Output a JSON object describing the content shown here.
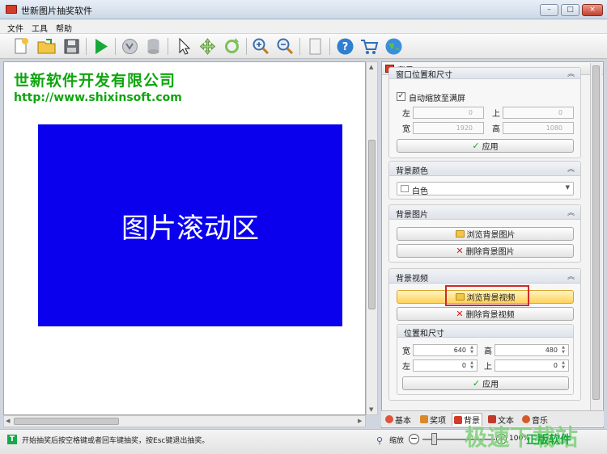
{
  "window": {
    "title": "世新图片抽奖软件",
    "controls": [
      "–",
      "□",
      "×"
    ]
  },
  "menu": [
    "文件",
    "工具",
    "帮助"
  ],
  "toolbar": {
    "icons": [
      "new-file-icon",
      "open-folder-icon",
      "save-icon",
      "play-icon",
      "filter-icon",
      "database-icon",
      "cursor-icon",
      "move-icon",
      "refresh-icon",
      "zoom-in-icon",
      "zoom-out-icon",
      "document-icon",
      "help-icon",
      "cart-icon",
      "globe-icon"
    ]
  },
  "canvas": {
    "company": "世新软件开发有限公司",
    "url": "http://www.shixinsoft.com",
    "scroll_area_text": "图片滚动区",
    "scroll_area_color": "#0a00ee"
  },
  "panel": {
    "title": "背景",
    "window_size_group": {
      "title": "窗口位置和尺寸",
      "auto_scale_label": "自动缩放至满屏",
      "auto_scale_checked": true,
      "left_label": "左",
      "left_value": "0",
      "top_label": "上",
      "top_value": "0",
      "width_label": "宽",
      "width_value": "1920",
      "height_label": "高",
      "height_value": "1080",
      "apply_label": "应用"
    },
    "bg_color_group": {
      "title": "背景颜色",
      "selected": "白色"
    },
    "bg_image_group": {
      "title": "背景图片",
      "browse_label": "浏览背景图片",
      "delete_label": "删除背景图片"
    },
    "bg_video_group": {
      "title": "背景视频",
      "browse_label": "浏览背景视频",
      "delete_label": "删除背景视频",
      "sub_title": "位置和尺寸",
      "width_label": "宽",
      "width_value": "640",
      "height_label": "高",
      "height_value": "480",
      "left_label": "左",
      "left_value": "0",
      "top_label": "上",
      "top_value": "0",
      "apply_label": "应用"
    }
  },
  "tabs": [
    "基本",
    "奖项",
    "背景",
    "文本",
    "音乐"
  ],
  "status": {
    "message": "开始抽奖后按空格键或者回车键抽奖，按Esc键退出抽奖。",
    "zoom_label": "缩放",
    "zoom_minus": "−",
    "zoom_plus": "+",
    "zoom_value": "100%"
  },
  "watermark": {
    "main": "极速下载站",
    "sub": "正版软件"
  }
}
